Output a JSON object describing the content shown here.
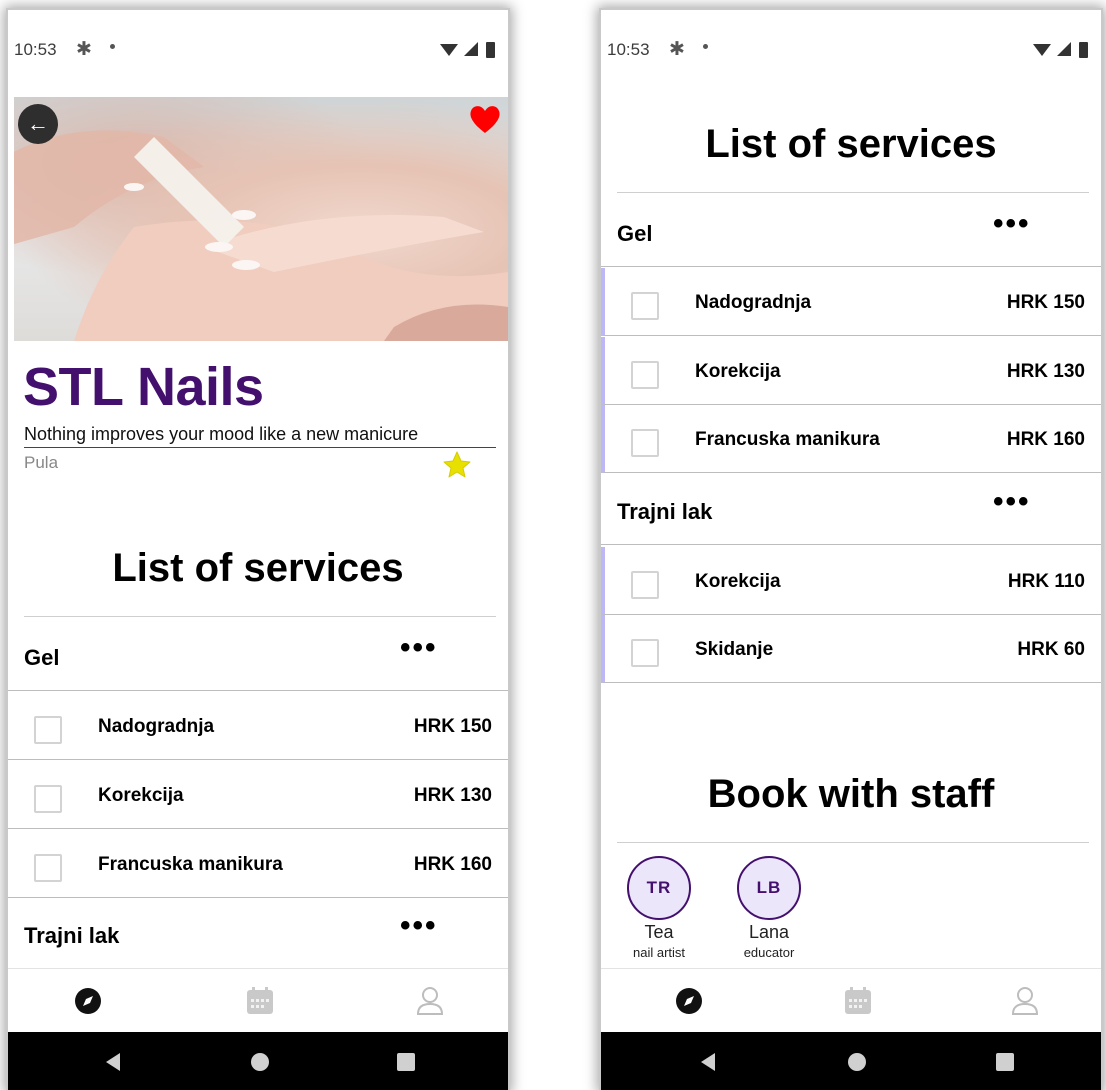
{
  "status_bar": {
    "time": "10:53"
  },
  "shop": {
    "name": "STL Nails",
    "tagline": "Nothing improves your mood like a new manicure",
    "city": "Pula"
  },
  "services_section": {
    "title": "List of services"
  },
  "categories": [
    {
      "name": "Gel",
      "more_label": "•••",
      "services": [
        {
          "name": "Nadogradnja",
          "price": "HRK 150"
        },
        {
          "name": "Korekcija",
          "price": "HRK 130"
        },
        {
          "name": "Francuska manikura",
          "price": "HRK 160"
        }
      ]
    },
    {
      "name": "Trajni lak",
      "more_label": "•••",
      "services": [
        {
          "name": "Korekcija",
          "price": "HRK 110"
        },
        {
          "name": "Skidanje",
          "price": "HRK 60"
        }
      ]
    }
  ],
  "staff_section": {
    "title": "Book with staff",
    "members": [
      {
        "initials": "TR",
        "name": "Tea",
        "role": "nail artist"
      },
      {
        "initials": "LB",
        "name": "Lana",
        "role": "educator"
      }
    ]
  },
  "colors": {
    "brand_purple": "#44106e",
    "accent_bar": "#bdb8f5",
    "favorite_heart": "#ff0000",
    "rating_star": "#e8e000"
  },
  "icons": {
    "back": "arrow-left-icon",
    "favorite": "heart-icon",
    "rating": "star-icon",
    "nav_explore": "compass-icon",
    "nav_calendar": "calendar-icon",
    "nav_profile": "user-icon"
  }
}
